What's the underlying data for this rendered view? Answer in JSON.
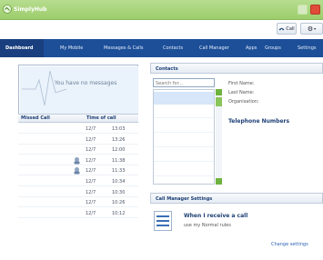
{
  "window": {
    "title": "SimplyHub"
  },
  "toolbar": {
    "call_label": "Call",
    "settings_glyph": "⚙"
  },
  "nav": {
    "tabs": [
      {
        "label": "Dashboard"
      },
      {
        "label": "My Mobile"
      },
      {
        "label": "Messages & Calls"
      },
      {
        "label": "Contacts"
      },
      {
        "label": "Call Manager"
      },
      {
        "label": "Apps"
      },
      {
        "label": "Groups"
      },
      {
        "label": "Settings"
      }
    ],
    "active": "Dashboard"
  },
  "messages": {
    "empty_text": "You have no messages"
  },
  "missed_calls": {
    "headers": {
      "from": "Missed Call",
      "time": "Time of call"
    },
    "rows": [
      {
        "date": "12/7",
        "time": "13:03",
        "voicemail": false
      },
      {
        "date": "12/7",
        "time": "13:26",
        "voicemail": false
      },
      {
        "date": "12/7",
        "time": "12:00",
        "voicemail": false
      },
      {
        "date": "12/7",
        "time": "11:38",
        "voicemail": true
      },
      {
        "date": "12/7",
        "time": "11:33",
        "voicemail": true
      },
      {
        "date": "12/7",
        "time": "10:34",
        "voicemail": false
      },
      {
        "date": "12/7",
        "time": "10:30",
        "voicemail": false
      },
      {
        "date": "12/7",
        "time": "10:26",
        "voicemail": false
      },
      {
        "date": "12/7",
        "time": "10:12",
        "voicemail": false
      }
    ]
  },
  "contacts": {
    "title": "Contacts",
    "search_placeholder": "Search for...",
    "fields": {
      "first_name": "First Name:",
      "last_name": "Last Name:",
      "organisation": "Organisation:"
    },
    "telephone_header": "Telephone Numbers"
  },
  "call_manager": {
    "title": "Call Manager Settings",
    "rule_title": "When I receive a call",
    "rule_desc": "use my Normal rules",
    "change_link": "Change settings"
  },
  "colors": {
    "nav_bg": "#1d4f98",
    "titlebar": "#9dcd6d",
    "accent_green": "#6fb33f",
    "link": "#2a62b5"
  }
}
